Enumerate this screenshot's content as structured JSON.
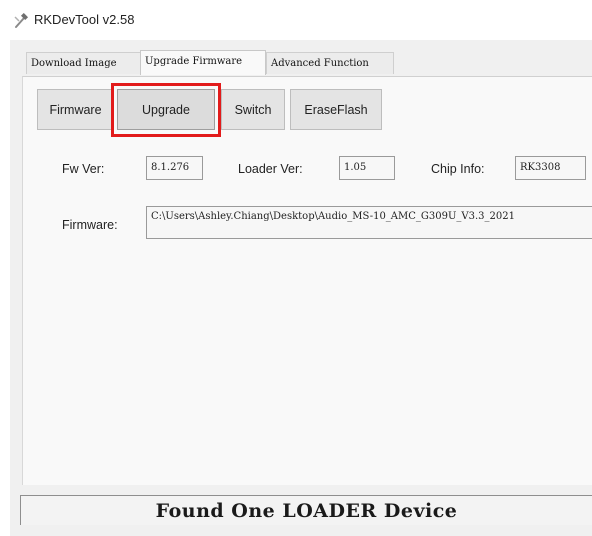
{
  "window": {
    "title": "RKDevTool v2.58",
    "icon": "hammer-icon"
  },
  "tabs": [
    {
      "label": "Download Image",
      "active": false
    },
    {
      "label": "Upgrade Firmware",
      "active": true
    },
    {
      "label": "Advanced Function",
      "active": false
    }
  ],
  "toolbar": {
    "firmware_label": "Firmware",
    "upgrade_label": "Upgrade",
    "switch_label": "Switch",
    "eraseflash_label": "EraseFlash",
    "highlight_color": "#e21b1b"
  },
  "info": {
    "fw_ver_label": "Fw Ver:",
    "fw_ver_value": "8.1.276",
    "loader_ver_label": "Loader Ver:",
    "loader_ver_value": "1.05",
    "chip_info_label": "Chip Info:",
    "chip_info_value": "RK3308",
    "firmware_label": "Firmware:",
    "firmware_path": "C:\\Users\\Ashley.Chiang\\Desktop\\Audio_MS-10_AMC_G309U_V3.3_2021"
  },
  "status": {
    "message": "Found One LOADER Device"
  }
}
